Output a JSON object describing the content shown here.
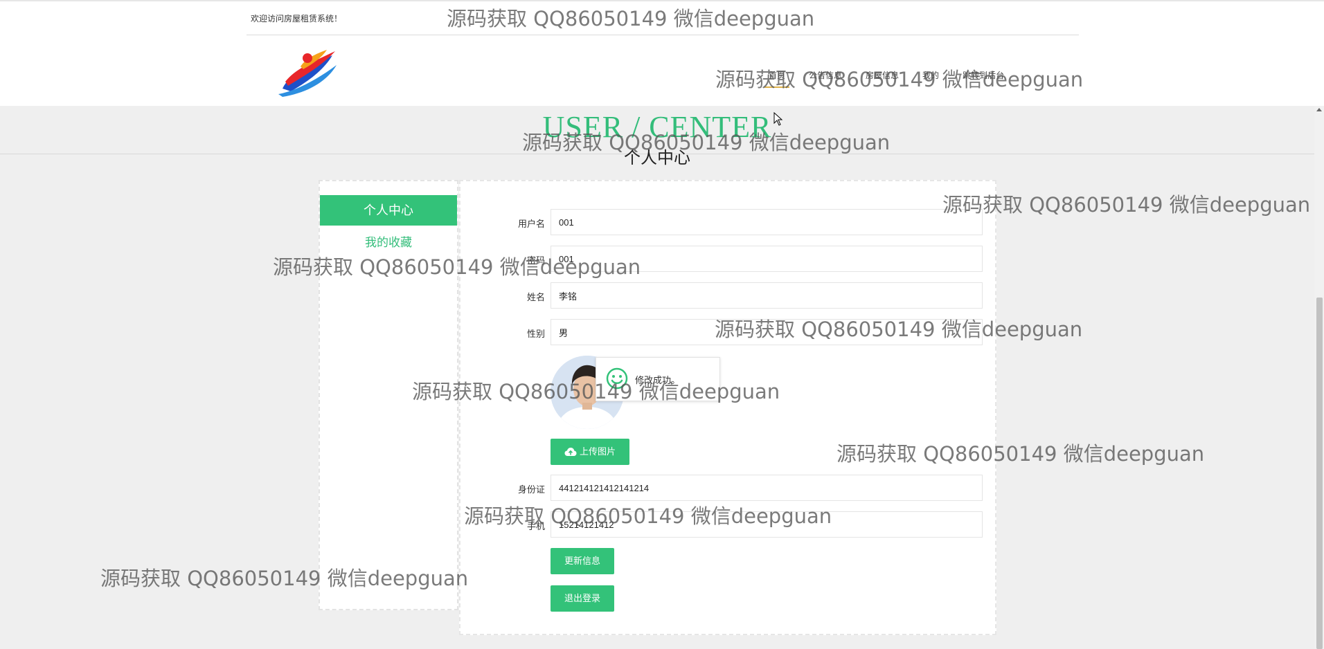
{
  "header": {
    "welcome": "欢迎访问房屋租赁系统！",
    "nav": [
      {
        "label": "首页",
        "active": true
      },
      {
        "label": "公告信息",
        "active": false
      },
      {
        "label": "房屋信息",
        "active": false
      },
      {
        "label": "我的",
        "active": false
      },
      {
        "label": "跳转到后台",
        "active": false
      }
    ]
  },
  "banner": {
    "title": "USER / CENTER",
    "subtitle": "个人中心"
  },
  "sidebar": {
    "active_item": "个人中心",
    "link_item": "我的收藏"
  },
  "form": {
    "username_label": "用户名",
    "username_value": "001",
    "password_label": "密码",
    "password_value": "001",
    "name_label": "姓名",
    "name_value": "李铭",
    "gender_label": "性别",
    "gender_value": "男",
    "upload_label": "上传图片",
    "idcard_label": "身份证",
    "idcard_value": "441214121412141214",
    "phone_label": "手机",
    "phone_value": "15214121412",
    "update_label": "更新信息",
    "logout_label": "退出登录"
  },
  "toast": {
    "message": "修改成功。"
  },
  "watermark": "源码获取 QQ86050149 微信deepguan",
  "colors": {
    "accent_green": "#33c279",
    "title_green": "#33bd7a",
    "nav_active_underline": "#e0b44c",
    "page_bg": "#efefef"
  }
}
